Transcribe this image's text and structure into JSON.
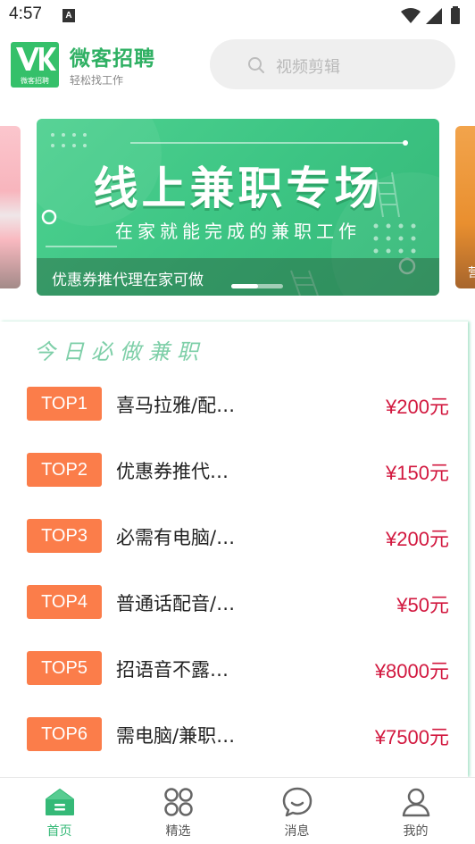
{
  "status_bar": {
    "time": "4:57",
    "notif_letter": "A"
  },
  "header": {
    "app_title": "微客招聘",
    "app_subtitle": "轻松找工作",
    "logo_caption": "微客招聘",
    "search": {
      "placeholder": "视频剪辑"
    }
  },
  "banner": {
    "title": "线上兼职专场",
    "subtitle": "在家就能完成的兼职工作",
    "caption": "优惠券推代理在家可做",
    "right_peek_char": "营",
    "slide_fraction_shown": 0.5
  },
  "section": {
    "title": "今日必做兼职",
    "jobs": [
      {
        "rank": "TOP1",
        "title": "喜马拉雅/配…",
        "price": "¥200元"
      },
      {
        "rank": "TOP2",
        "title": "优惠券推代…",
        "price": "¥150元"
      },
      {
        "rank": "TOP3",
        "title": "必需有电脑/…",
        "price": "¥200元"
      },
      {
        "rank": "TOP4",
        "title": "普通话配音/…",
        "price": "¥50元"
      },
      {
        "rank": "TOP5",
        "title": "招语音不露…",
        "price": "¥8000元"
      },
      {
        "rank": "TOP6",
        "title": "需电脑/兼职…",
        "price": "¥7500元"
      }
    ]
  },
  "bottom_nav": {
    "items": [
      {
        "label": "首页",
        "icon": "home-icon",
        "active": true
      },
      {
        "label": "精选",
        "icon": "grid-icon",
        "active": false
      },
      {
        "label": "消息",
        "icon": "chat-icon",
        "active": false
      },
      {
        "label": "我的",
        "icon": "user-icon",
        "active": false
      }
    ]
  },
  "colors": {
    "brand_green": "#35c06a",
    "badge_orange": "#fb7d4a",
    "price_red": "#d2183f",
    "nav_active": "#35b977"
  }
}
